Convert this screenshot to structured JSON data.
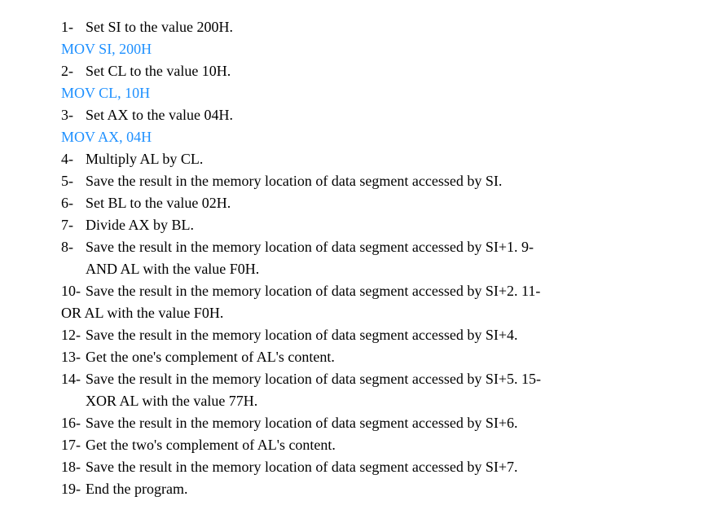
{
  "lines": {
    "l1_num": "1-",
    "l1_text": "Set SI to the value 200H.",
    "l1_code": "MOV SI, 200H",
    "l2_num": "2-",
    "l2_text": "Set CL to the value 10H.",
    "l2_code": "MOV CL, 10H",
    "l3_num": "3-",
    "l3_text": "Set AX to the value 04H.",
    "l3_code": "MOV AX, 04H",
    "l4_num": "4-",
    "l4_text": "Multiply AL by CL.",
    "l5_num": "5-",
    "l5_text": "Save the result in the memory location of data segment accessed by SI.",
    "l6_num": "6-",
    "l6_text": "Set BL to the value 02H.",
    "l7_num": "7-",
    "l7_text": "Divide AX by BL.",
    "l8_num": "8-",
    "l8_text": "Save the result in the memory location of data segment accessed by SI+1. 9-",
    "l8b_text": "AND AL with the value F0H.",
    "l10_num": "10-",
    "l10_text": "Save the result in the memory location of data segment accessed by SI+2. 11-",
    "l11_text": "OR AL with the value F0H.",
    "l12_num": "12-",
    "l12_text": "Save the result in the memory location of data segment accessed by SI+4.",
    "l13_num": "13-",
    "l13_text": "Get the one's complement of AL's content.",
    "l14_num": "14-",
    "l14_text": "Save the result in the memory location of data segment accessed by SI+5. 15-",
    "l14b_text": "XOR AL with the value 77H.",
    "l16_num": "16-",
    "l16_text": "Save the result in the memory location of data segment accessed by SI+6.",
    "l17_num": "17-",
    "l17_text": "Get the two's complement of AL's content.",
    "l18_num": "18-",
    "l18_text": "Save the result in the memory location of data segment accessed by SI+7.",
    "l19_num": "19-",
    "l19_text": "End the program."
  }
}
